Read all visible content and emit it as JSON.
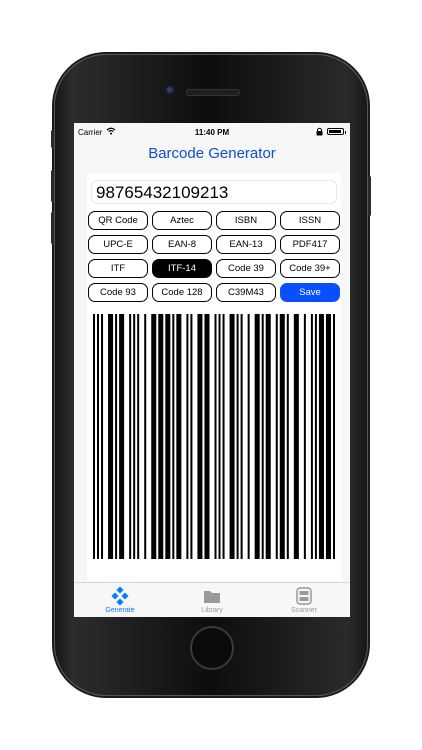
{
  "status_bar": {
    "carrier": "Carrier",
    "time": "11:40 PM",
    "battery_level": 0.9
  },
  "nav": {
    "title": "Barcode Generator"
  },
  "input": {
    "value": "98765432109213"
  },
  "type_buttons": [
    {
      "label": "QR Code"
    },
    {
      "label": "Aztec"
    },
    {
      "label": "ISBN"
    },
    {
      "label": "ISSN"
    },
    {
      "label": "UPC-E"
    },
    {
      "label": "EAN-8"
    },
    {
      "label": "EAN-13"
    },
    {
      "label": "PDF417"
    },
    {
      "label": "ITF"
    },
    {
      "label": "ITF-14",
      "selected": true
    },
    {
      "label": "Code 39"
    },
    {
      "label": "Code 39+"
    },
    {
      "label": "Code 93"
    },
    {
      "label": "Code 128"
    },
    {
      "label": "C39M43"
    },
    {
      "label": "Save",
      "primary": true
    }
  ],
  "barcode": {
    "symbology": "ITF-14",
    "encoded_value": "98765432109213"
  },
  "tabs": [
    {
      "label": "Generate",
      "icon": "generate-icon",
      "active": true
    },
    {
      "label": "Library",
      "icon": "folder-icon",
      "active": false
    },
    {
      "label": "Scanner",
      "icon": "scanner-icon",
      "active": false
    }
  ],
  "colors": {
    "accent": "#0a4fd6",
    "save_button": "#0a4fff",
    "selected_button": "#000000",
    "inactive_tab": "#9a9a9a"
  }
}
